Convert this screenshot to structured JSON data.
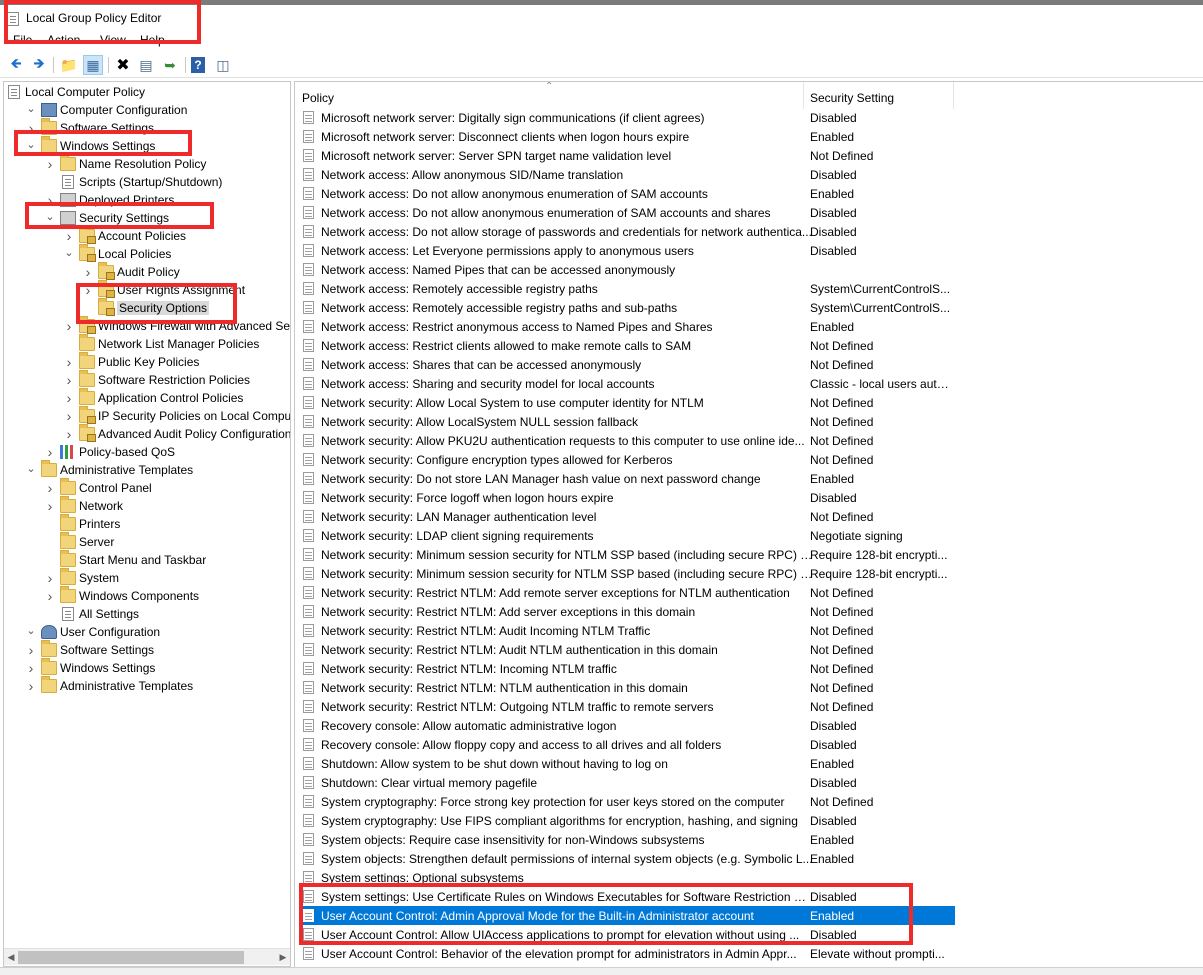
{
  "window": {
    "title": "Local Group Policy Editor"
  },
  "menu": [
    "File",
    "Action",
    "View",
    "Help"
  ],
  "toolbar": {
    "buttons": [
      "back-icon",
      "forward-icon",
      "up-folder-icon",
      "show-hide-tree-icon",
      "delete-icon",
      "properties-icon",
      "export-list-icon",
      "help-icon",
      "view-icon"
    ]
  },
  "tree": [
    {
      "label": "Local Computer Policy",
      "icon": "doc-icon",
      "level": 0,
      "toggle": ""
    },
    {
      "label": "Computer Configuration",
      "icon": "computer-icon",
      "level": 1,
      "toggle": "expanded"
    },
    {
      "label": "Software Settings",
      "icon": "folder-icon",
      "level": 2,
      "toggle": "collapsed"
    },
    {
      "label": "Windows Settings",
      "icon": "folder-icon",
      "level": 2,
      "toggle": "expanded"
    },
    {
      "label": "Name Resolution Policy",
      "icon": "folder-icon",
      "level": 3,
      "toggle": "collapsed"
    },
    {
      "label": "Scripts (Startup/Shutdown)",
      "icon": "doc-icon",
      "level": 3,
      "toggle": ""
    },
    {
      "label": "Deployed Printers",
      "icon": "printer-icon",
      "level": 3,
      "toggle": "collapsed"
    },
    {
      "label": "Security Settings",
      "icon": "security-icon",
      "level": 3,
      "toggle": "expanded"
    },
    {
      "label": "Account Policies",
      "icon": "lock-folder-icon",
      "level": 4,
      "toggle": "collapsed"
    },
    {
      "label": "Local Policies",
      "icon": "lock-folder-icon",
      "level": 4,
      "toggle": "expanded"
    },
    {
      "label": "Audit Policy",
      "icon": "lock-folder-icon",
      "level": 5,
      "toggle": "collapsed"
    },
    {
      "label": "User Rights Assignment",
      "icon": "lock-folder-icon",
      "level": 5,
      "toggle": "collapsed"
    },
    {
      "label": "Security Options",
      "icon": "lock-folder-icon",
      "level": 5,
      "toggle": "",
      "selected": true
    },
    {
      "label": "Windows Firewall with Advanced Security",
      "icon": "lock-folder-icon",
      "level": 4,
      "toggle": "collapsed"
    },
    {
      "label": "Network List Manager Policies",
      "icon": "folder-icon",
      "level": 4,
      "toggle": ""
    },
    {
      "label": "Public Key Policies",
      "icon": "folder-icon",
      "level": 4,
      "toggle": "collapsed"
    },
    {
      "label": "Software Restriction Policies",
      "icon": "folder-icon",
      "level": 4,
      "toggle": "collapsed"
    },
    {
      "label": "Application Control Policies",
      "icon": "folder-icon",
      "level": 4,
      "toggle": "collapsed"
    },
    {
      "label": "IP Security Policies on Local Computer",
      "icon": "lock-folder-icon",
      "level": 4,
      "toggle": "collapsed"
    },
    {
      "label": "Advanced Audit Policy Configuration",
      "icon": "lock-folder-icon",
      "level": 4,
      "toggle": "collapsed"
    },
    {
      "label": "Policy-based QoS",
      "icon": "chart-icon",
      "level": 3,
      "toggle": "collapsed"
    },
    {
      "label": "Administrative Templates",
      "icon": "folder-icon",
      "level": 2,
      "toggle": "expanded"
    },
    {
      "label": "Control Panel",
      "icon": "folder-icon",
      "level": 3,
      "toggle": "collapsed"
    },
    {
      "label": "Network",
      "icon": "folder-icon",
      "level": 3,
      "toggle": "collapsed"
    },
    {
      "label": "Printers",
      "icon": "folder-icon",
      "level": 3,
      "toggle": ""
    },
    {
      "label": "Server",
      "icon": "folder-icon",
      "level": 3,
      "toggle": ""
    },
    {
      "label": "Start Menu and Taskbar",
      "icon": "folder-icon",
      "level": 3,
      "toggle": ""
    },
    {
      "label": "System",
      "icon": "folder-icon",
      "level": 3,
      "toggle": "collapsed"
    },
    {
      "label": "Windows Components",
      "icon": "folder-icon",
      "level": 3,
      "toggle": "collapsed"
    },
    {
      "label": "All Settings",
      "icon": "doc-icon",
      "level": 3,
      "toggle": ""
    },
    {
      "label": "User Configuration",
      "icon": "user-icon",
      "level": 1,
      "toggle": "expanded"
    },
    {
      "label": "Software Settings",
      "icon": "folder-icon",
      "level": 2,
      "toggle": "collapsed"
    },
    {
      "label": "Windows Settings",
      "icon": "folder-icon",
      "level": 2,
      "toggle": "collapsed"
    },
    {
      "label": "Administrative Templates",
      "icon": "folder-icon",
      "level": 2,
      "toggle": "collapsed"
    }
  ],
  "list": {
    "columns": {
      "policy": "Policy",
      "setting": "Security Setting"
    },
    "rows": [
      {
        "policy": "Microsoft network server: Digitally sign communications (if client agrees)",
        "setting": "Disabled"
      },
      {
        "policy": "Microsoft network server: Disconnect clients when logon hours expire",
        "setting": "Enabled"
      },
      {
        "policy": "Microsoft network server: Server SPN target name validation level",
        "setting": "Not Defined"
      },
      {
        "policy": "Network access: Allow anonymous SID/Name translation",
        "setting": "Disabled"
      },
      {
        "policy": "Network access: Do not allow anonymous enumeration of SAM accounts",
        "setting": "Enabled"
      },
      {
        "policy": "Network access: Do not allow anonymous enumeration of SAM accounts and shares",
        "setting": "Disabled"
      },
      {
        "policy": "Network access: Do not allow storage of passwords and credentials for network authentica...",
        "setting": "Disabled"
      },
      {
        "policy": "Network access: Let Everyone permissions apply to anonymous users",
        "setting": "Disabled"
      },
      {
        "policy": "Network access: Named Pipes that can be accessed anonymously",
        "setting": ""
      },
      {
        "policy": "Network access: Remotely accessible registry paths",
        "setting": "System\\CurrentControlS..."
      },
      {
        "policy": "Network access: Remotely accessible registry paths and sub-paths",
        "setting": "System\\CurrentControlS..."
      },
      {
        "policy": "Network access: Restrict anonymous access to Named Pipes and Shares",
        "setting": "Enabled"
      },
      {
        "policy": "Network access: Restrict clients allowed to make remote calls to SAM",
        "setting": "Not Defined"
      },
      {
        "policy": "Network access: Shares that can be accessed anonymously",
        "setting": "Not Defined"
      },
      {
        "policy": "Network access: Sharing and security model for local accounts",
        "setting": "Classic - local users auth..."
      },
      {
        "policy": "Network security: Allow Local System to use computer identity for NTLM",
        "setting": "Not Defined"
      },
      {
        "policy": "Network security: Allow LocalSystem NULL session fallback",
        "setting": "Not Defined"
      },
      {
        "policy": "Network security: Allow PKU2U authentication requests to this computer to use online ide...",
        "setting": "Not Defined"
      },
      {
        "policy": "Network security: Configure encryption types allowed for Kerberos",
        "setting": "Not Defined"
      },
      {
        "policy": "Network security: Do not store LAN Manager hash value on next password change",
        "setting": "Enabled"
      },
      {
        "policy": "Network security: Force logoff when logon hours expire",
        "setting": "Disabled"
      },
      {
        "policy": "Network security: LAN Manager authentication level",
        "setting": "Not Defined"
      },
      {
        "policy": "Network security: LDAP client signing requirements",
        "setting": "Negotiate signing"
      },
      {
        "policy": "Network security: Minimum session security for NTLM SSP based (including secure RPC) c...",
        "setting": "Require 128-bit encrypti..."
      },
      {
        "policy": "Network security: Minimum session security for NTLM SSP based (including secure RPC) s...",
        "setting": "Require 128-bit encrypti..."
      },
      {
        "policy": "Network security: Restrict NTLM: Add remote server exceptions for NTLM authentication",
        "setting": "Not Defined"
      },
      {
        "policy": "Network security: Restrict NTLM: Add server exceptions in this domain",
        "setting": "Not Defined"
      },
      {
        "policy": "Network security: Restrict NTLM: Audit Incoming NTLM Traffic",
        "setting": "Not Defined"
      },
      {
        "policy": "Network security: Restrict NTLM: Audit NTLM authentication in this domain",
        "setting": "Not Defined"
      },
      {
        "policy": "Network security: Restrict NTLM: Incoming NTLM traffic",
        "setting": "Not Defined"
      },
      {
        "policy": "Network security: Restrict NTLM: NTLM authentication in this domain",
        "setting": "Not Defined"
      },
      {
        "policy": "Network security: Restrict NTLM: Outgoing NTLM traffic to remote servers",
        "setting": "Not Defined"
      },
      {
        "policy": "Recovery console: Allow automatic administrative logon",
        "setting": "Disabled"
      },
      {
        "policy": "Recovery console: Allow floppy copy and access to all drives and all folders",
        "setting": "Disabled"
      },
      {
        "policy": "Shutdown: Allow system to be shut down without having to log on",
        "setting": "Enabled"
      },
      {
        "policy": "Shutdown: Clear virtual memory pagefile",
        "setting": "Disabled"
      },
      {
        "policy": "System cryptography: Force strong key protection for user keys stored on the computer",
        "setting": "Not Defined"
      },
      {
        "policy": "System cryptography: Use FIPS compliant algorithms for encryption, hashing, and signing",
        "setting": "Disabled"
      },
      {
        "policy": "System objects: Require case insensitivity for non-Windows subsystems",
        "setting": "Enabled"
      },
      {
        "policy": "System objects: Strengthen default permissions of internal system objects (e.g. Symbolic L...",
        "setting": "Enabled"
      },
      {
        "policy": "System settings: Optional subsystems",
        "setting": ""
      },
      {
        "policy": "System settings: Use Certificate Rules on Windows Executables for Software Restriction Pol...",
        "setting": "Disabled"
      },
      {
        "policy": "User Account Control: Admin Approval Mode for the Built-in Administrator account",
        "setting": "Enabled",
        "selected": true
      },
      {
        "policy": "User Account Control: Allow UIAccess applications to prompt for elevation without using ...",
        "setting": "Disabled"
      },
      {
        "policy": "User Account Control: Behavior of the elevation prompt for administrators in Admin Appr...",
        "setting": "Elevate without prompti..."
      }
    ]
  },
  "colors": {
    "selection": "#0078d7",
    "highlight_box": "#ee2a2a"
  }
}
